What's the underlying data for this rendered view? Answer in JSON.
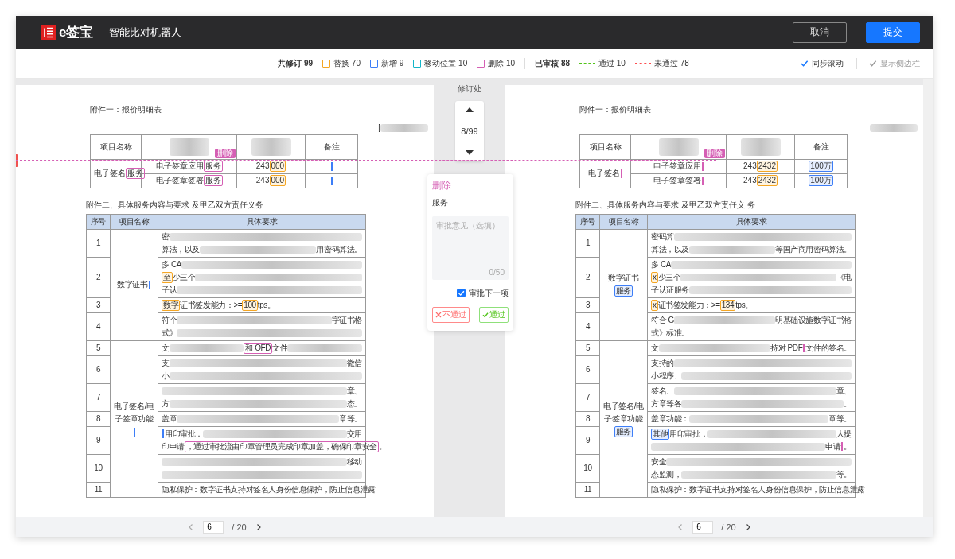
{
  "header": {
    "logo_text": "e签宝",
    "title": "智能比对机器人",
    "buttons": [
      {
        "label": "取消",
        "kind": "secondary"
      },
      {
        "label": "提交",
        "kind": "primary"
      }
    ]
  },
  "toolbar": {
    "stats": [
      {
        "label": "共修订 99",
        "kind": "total"
      },
      {
        "label": "替换 70",
        "kind": "box",
        "color": "#f5a623"
      },
      {
        "label": "新增 9",
        "kind": "box",
        "color": "#3d7ef7"
      },
      {
        "label": "移动位置 10",
        "kind": "box",
        "color": "#13b5c8"
      },
      {
        "label": "删除 10",
        "kind": "box",
        "color": "#d55fb4"
      },
      {
        "label": "已审核 88",
        "kind": "total"
      },
      {
        "label": "通过 10",
        "kind": "line",
        "color": "#52c41a"
      },
      {
        "label": "未通过 78",
        "kind": "line",
        "color": "#ff4d4f"
      }
    ],
    "toggles": [
      {
        "label": "同步滚动",
        "checked": true
      },
      {
        "label": "显示侧边栏",
        "checked": false
      }
    ]
  },
  "documents": [
    {
      "heading_1": "附件一：报价明细表",
      "note": [
        {
          "text": "[",
          "kind": "plain"
        },
        {
          "kind": "redacted"
        }
      ],
      "price_table": {
        "header_cells": [
          [
            {
              "text": "项目名称",
              "kind": "plain"
            }
          ],
          [
            {
              "kind": "redacted"
            }
          ],
          [
            {
              "kind": "redacted"
            }
          ],
          [
            {
              "text": "备注",
              "kind": "plain"
            }
          ]
        ],
        "change_tag": "删除",
        "group": [
          {
            "text": "电子签名",
            "kind": "plain"
          },
          {
            "text": "服务",
            "kind": "delete"
          }
        ],
        "rows": [
          [
            [
              {
                "text": "电子签章应用",
                "kind": "plain"
              },
              {
                "text": "服务",
                "kind": "delete"
              }
            ],
            [
              {
                "text": "243",
                "kind": "plain"
              },
              {
                "text": "000",
                "kind": "replace"
              }
            ],
            [
              {
                "kind": "insert"
              }
            ]
          ],
          [
            [
              {
                "text": "电子签章签署",
                "kind": "plain"
              },
              {
                "text": "服务",
                "kind": "delete"
              }
            ],
            [
              {
                "text": "243",
                "kind": "plain"
              },
              {
                "text": "000",
                "kind": "replace"
              }
            ],
            [
              {
                "kind": "insert"
              }
            ]
          ]
        ]
      },
      "heading_2": "附件二、具体服务内容与要求 及甲乙双方责任义务",
      "requirements": {
        "columns": [
          "序号",
          "项目名称",
          "具体要求"
        ],
        "groups": [
          {
            "name": [
              {
                "text": "数字证书",
                "kind": "plain"
              },
              {
                "kind": "insert"
              }
            ],
            "rows": [
              {
                "no": "1",
                "lines": [
                  [
                    {
                      "text": "密",
                      "kind": "plain"
                    },
                    {
                      "kind": "redacted"
                    }
                  ],
                  [
                    {
                      "text": "算法，以及",
                      "kind": "plain"
                    },
                    {
                      "kind": "redacted"
                    },
                    {
                      "text": "用密码算法。",
                      "kind": "plain"
                    }
                  ]
                ]
              },
              {
                "no": "2",
                "lines": [
                  [
                    {
                      "text": "多 CA",
                      "kind": "plain"
                    },
                    {
                      "kind": "redacted"
                    }
                  ],
                  [
                    {
                      "text": "至",
                      "kind": "replace"
                    },
                    {
                      "text": "少三个",
                      "kind": "plain"
                    },
                    {
                      "kind": "redacted"
                    }
                  ],
                  [
                    {
                      "text": "子认",
                      "kind": "plain"
                    },
                    {
                      "kind": "redacted"
                    }
                  ]
                ]
              },
              {
                "no": "3",
                "lines": [
                  [
                    {
                      "text": "数字",
                      "kind": "replace"
                    },
                    {
                      "text": "证书签发能力：>=",
                      "kind": "plain"
                    },
                    {
                      "text": "100",
                      "kind": "replace"
                    },
                    {
                      "text": "tps。",
                      "kind": "plain"
                    }
                  ]
                ]
              },
              {
                "no": "4",
                "lines": [
                  [
                    {
                      "text": "符个",
                      "kind": "plain"
                    },
                    {
                      "kind": "redacted"
                    },
                    {
                      "text": "字证书格",
                      "kind": "plain"
                    }
                  ],
                  [
                    {
                      "text": "式》",
                      "kind": "plain"
                    },
                    {
                      "kind": "redacted"
                    }
                  ]
                ]
              }
            ]
          },
          {
            "name": [
              {
                "text": "电子签名/电子签章功能",
                "kind": "plain"
              },
              {
                "kind": "insert"
              }
            ],
            "rows": [
              {
                "no": "5",
                "lines": [
                  [
                    {
                      "text": "文",
                      "kind": "plain"
                    },
                    {
                      "kind": "redacted"
                    },
                    {
                      "text": "和 OFD",
                      "kind": "delete"
                    },
                    {
                      "text": "文件",
                      "kind": "plain"
                    },
                    {
                      "kind": "redacted"
                    }
                  ]
                ]
              },
              {
                "no": "6",
                "lines": [
                  [
                    {
                      "text": "支",
                      "kind": "plain"
                    },
                    {
                      "kind": "redacted"
                    },
                    {
                      "text": "微信",
                      "kind": "plain"
                    }
                  ],
                  [
                    {
                      "text": "小",
                      "kind": "plain"
                    },
                    {
                      "kind": "redacted"
                    }
                  ]
                ]
              },
              {
                "no": "7",
                "lines": [
                  [
                    {
                      "kind": "redacted"
                    },
                    {
                      "text": "章、",
                      "kind": "plain"
                    }
                  ],
                  [
                    {
                      "text": "方",
                      "kind": "plain"
                    },
                    {
                      "kind": "redacted"
                    },
                    {
                      "text": "态。",
                      "kind": "plain"
                    }
                  ]
                ]
              },
              {
                "no": "8",
                "lines": [
                  [
                    {
                      "text": "盖章",
                      "kind": "plain"
                    },
                    {
                      "kind": "redacted"
                    },
                    {
                      "text": "章等。",
                      "kind": "plain"
                    }
                  ]
                ]
              },
              {
                "no": "9",
                "lines": [
                  [
                    {
                      "kind": "insert"
                    },
                    {
                      "text": "用印审批：",
                      "kind": "plain"
                    },
                    {
                      "kind": "redacted"
                    },
                    {
                      "text": "交用",
                      "kind": "plain"
                    }
                  ],
                  [
                    {
                      "text": "印申请",
                      "kind": "plain"
                    },
                    {
                      "text": "，通过审批流由印章管理员完成印章加盖，确保印章安全",
                      "kind": "delete"
                    },
                    {
                      "text": "。",
                      "kind": "plain"
                    }
                  ]
                ]
              },
              {
                "no": "10",
                "lines": [
                  [
                    {
                      "kind": "redacted"
                    },
                    {
                      "text": "移动",
                      "kind": "plain"
                    }
                  ],
                  [
                    {
                      "kind": "redacted"
                    }
                  ]
                ]
              },
              {
                "no": "11",
                "lines": [
                  [
                    {
                      "text": "隐私保护：数字证书支持对签名人身份信息保护，防止信息泄露",
                      "kind": "plain"
                    }
                  ]
                ]
              }
            ]
          }
        ]
      },
      "pager": {
        "page": "6",
        "total": "/ 20"
      }
    },
    {
      "heading_1": "附件一：报价明细表",
      "note": [
        {
          "kind": "redacted"
        }
      ],
      "price_table": {
        "header_cells": [
          [
            {
              "text": "项目名称",
              "kind": "plain"
            }
          ],
          [
            {
              "kind": "redacted"
            }
          ],
          [
            {
              "kind": "redacted"
            }
          ],
          [
            {
              "text": "备注",
              "kind": "plain"
            }
          ]
        ],
        "change_tag": "删除",
        "group": [
          {
            "text": "电子签名",
            "kind": "plain"
          },
          {
            "kind": "remove"
          }
        ],
        "rows": [
          [
            [
              {
                "text": "电子签章应用",
                "kind": "plain"
              },
              {
                "kind": "remove"
              }
            ],
            [
              {
                "text": "243",
                "kind": "plain"
              },
              {
                "text": "2432",
                "kind": "replace"
              }
            ],
            [
              {
                "text": "100万",
                "kind": "add"
              }
            ]
          ],
          [
            [
              {
                "text": "电子签章签署",
                "kind": "plain"
              },
              {
                "kind": "remove"
              }
            ],
            [
              {
                "text": "243",
                "kind": "plain"
              },
              {
                "text": "2432",
                "kind": "replace"
              }
            ],
            [
              {
                "text": "100万",
                "kind": "add"
              }
            ]
          ]
        ]
      },
      "heading_2": "附件二、具体服务内容与要求 及甲乙双方责任义 务",
      "requirements": {
        "columns": [
          "序号",
          "项目名称",
          "具体要求"
        ],
        "groups": [
          {
            "name": [
              {
                "text": "数字证书",
                "kind": "plain"
              },
              {
                "text": "服务",
                "kind": "add"
              }
            ],
            "rows": [
              {
                "no": "1",
                "lines": [
                  [
                    {
                      "text": "密码算",
                      "kind": "plain"
                    },
                    {
                      "kind": "redacted"
                    }
                  ],
                  [
                    {
                      "text": "算法，以及",
                      "kind": "plain"
                    },
                    {
                      "kind": "redacted"
                    },
                    {
                      "text": "等国产商用密码算法。",
                      "kind": "plain"
                    }
                  ]
                ]
              },
              {
                "no": "2",
                "lines": [
                  [
                    {
                      "text": "多 CA",
                      "kind": "plain"
                    },
                    {
                      "kind": "redacted"
                    }
                  ],
                  [
                    {
                      "text": "x",
                      "kind": "replace"
                    },
                    {
                      "text": "少三个",
                      "kind": "plain"
                    },
                    {
                      "kind": "redacted"
                    },
                    {
                      "text": "《电",
                      "kind": "plain"
                    }
                  ],
                  [
                    {
                      "text": "子认证服务",
                      "kind": "plain"
                    },
                    {
                      "kind": "redacted"
                    }
                  ]
                ]
              },
              {
                "no": "3",
                "lines": [
                  [
                    {
                      "text": "x",
                      "kind": "replace"
                    },
                    {
                      "text": "证书签发能力：>=",
                      "kind": "plain"
                    },
                    {
                      "text": "134",
                      "kind": "replace"
                    },
                    {
                      "text": "tps。",
                      "kind": "plain"
                    }
                  ]
                ]
              },
              {
                "no": "4",
                "lines": [
                  [
                    {
                      "text": "符合 G",
                      "kind": "plain"
                    },
                    {
                      "kind": "redacted"
                    },
                    {
                      "text": "明基础设施数字证书格",
                      "kind": "plain"
                    }
                  ],
                  [
                    {
                      "text": "式》标准。",
                      "kind": "plain"
                    }
                  ]
                ]
              }
            ]
          },
          {
            "name": [
              {
                "text": "电子签名/电子签章功能",
                "kind": "plain"
              },
              {
                "text": "服务",
                "kind": "add"
              }
            ],
            "rows": [
              {
                "no": "5",
                "lines": [
                  [
                    {
                      "text": "文",
                      "kind": "plain"
                    },
                    {
                      "kind": "redacted"
                    },
                    {
                      "text": "持对 PDF",
                      "kind": "plain"
                    },
                    {
                      "kind": "remove"
                    },
                    {
                      "text": "文件的签名。",
                      "kind": "plain"
                    }
                  ]
                ]
              },
              {
                "no": "6",
                "lines": [
                  [
                    {
                      "text": "支持的",
                      "kind": "plain"
                    },
                    {
                      "kind": "redacted"
                    }
                  ],
                  [
                    {
                      "text": "小程序、",
                      "kind": "plain"
                    },
                    {
                      "kind": "redacted"
                    }
                  ]
                ]
              },
              {
                "no": "7",
                "lines": [
                  [
                    {
                      "text": "签名、",
                      "kind": "plain"
                    },
                    {
                      "kind": "redacted"
                    },
                    {
                      "text": "章、",
                      "kind": "plain"
                    }
                  ],
                  [
                    {
                      "text": "方章等各",
                      "kind": "plain"
                    },
                    {
                      "kind": "redacted"
                    },
                    {
                      "text": "。",
                      "kind": "plain"
                    }
                  ]
                ]
              },
              {
                "no": "8",
                "lines": [
                  [
                    {
                      "text": "盖章功能：",
                      "kind": "plain"
                    },
                    {
                      "kind": "redacted"
                    },
                    {
                      "text": "章等。",
                      "kind": "plain"
                    }
                  ]
                ]
              },
              {
                "no": "9",
                "lines": [
                  [
                    {
                      "text": "其他",
                      "kind": "add"
                    },
                    {
                      "text": "用印审批：",
                      "kind": "plain"
                    },
                    {
                      "kind": "redacted"
                    },
                    {
                      "text": "人提",
                      "kind": "plain"
                    }
                  ],
                  [
                    {
                      "kind": "redacted"
                    },
                    {
                      "text": "申请",
                      "kind": "plain"
                    },
                    {
                      "kind": "remove"
                    },
                    {
                      "text": "。",
                      "kind": "plain"
                    }
                  ]
                ]
              },
              {
                "no": "10",
                "lines": [
                  [
                    {
                      "text": "安全",
                      "kind": "plain"
                    },
                    {
                      "kind": "redacted"
                    }
                  ],
                  [
                    {
                      "text": "态监测，",
                      "kind": "plain"
                    },
                    {
                      "kind": "redacted"
                    },
                    {
                      "text": "等。",
                      "kind": "plain"
                    }
                  ]
                ]
              },
              {
                "no": "11",
                "lines": [
                  [
                    {
                      "text": "隐私保护：数字证书支持对签名人身份信息保护，防止信息泄露",
                      "kind": "plain"
                    }
                  ]
                ]
              }
            ]
          }
        ]
      },
      "pager": {
        "page": "6",
        "total": "/ 20"
      }
    }
  ],
  "navigator": {
    "title": "修订处",
    "position": "8/99"
  },
  "review_card": {
    "type_label": "删除",
    "content": "服务",
    "comment": {
      "placeholder": "审批意见（选填）",
      "counter": "0/50"
    },
    "next_item": {
      "label": "审批下一项",
      "checked": true
    },
    "buttons": [
      {
        "label": "不通过",
        "kind": "reject"
      },
      {
        "label": "通过",
        "kind": "approve"
      }
    ]
  }
}
